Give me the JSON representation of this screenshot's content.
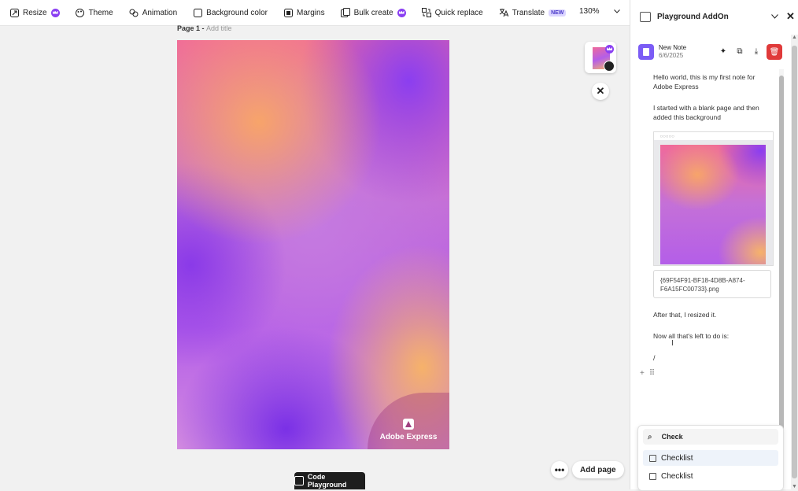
{
  "toolbar": {
    "resize": "Resize",
    "theme": "Theme",
    "animation": "Animation",
    "background_color": "Background color",
    "margins": "Margins",
    "bulk_create": "Bulk create",
    "quick_replace": "Quick replace",
    "translate": "Translate",
    "translate_badge": "NEW",
    "zoom": "130%"
  },
  "canvas": {
    "page_label": "Page 1 - ",
    "add_title": "Add title",
    "watermark": "Adobe Express",
    "add_page": "Add page",
    "code_playground": "Code Playground"
  },
  "panel": {
    "title": "Playground AddOn",
    "note": {
      "title": "New Note",
      "date": "6/6/2025",
      "para1": "Hello world, this is my first note for Adobe Express",
      "para2": "I started with a blank page and then added this background",
      "filename": "{69F54F91-BF18-4D8B-A874-F6A15FC00733}.png",
      "after": "After that, I resized it.",
      "now": "Now all that's left to do is:",
      "slash": "/"
    },
    "popup": {
      "search": "Check",
      "options": [
        "Checklist",
        "Checklist"
      ]
    }
  },
  "colors": {
    "accent": "#8a3ff2",
    "note_icon": "#7b5cf5",
    "delete": "#e03a3a"
  }
}
